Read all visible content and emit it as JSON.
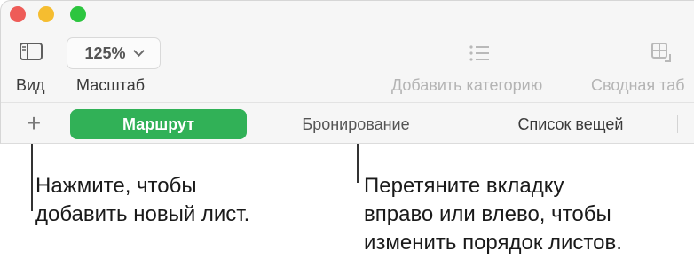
{
  "toolbar": {
    "zoom_value": "125%",
    "view_label": "Вид",
    "zoom_label": "Масштаб",
    "add_category_label": "Добавить категорию",
    "pivot_label": "Сводная таб"
  },
  "tabs": {
    "add_label": "+",
    "items": [
      {
        "label": "Маршрут",
        "active": true
      },
      {
        "label": "Бронирование",
        "active": false
      },
      {
        "label": "Список вещей",
        "active": false
      }
    ]
  },
  "callouts": {
    "add_sheet": "Нажмите, чтобы\nдобавить новый лист.",
    "reorder": "Перетяните вкладку\nвправо или влево, чтобы\nизменить порядок листов."
  },
  "colors": {
    "close": "#ee5c58",
    "minimize": "#f5bd30",
    "maximize": "#2cc53f",
    "active_tab": "#31b157"
  }
}
